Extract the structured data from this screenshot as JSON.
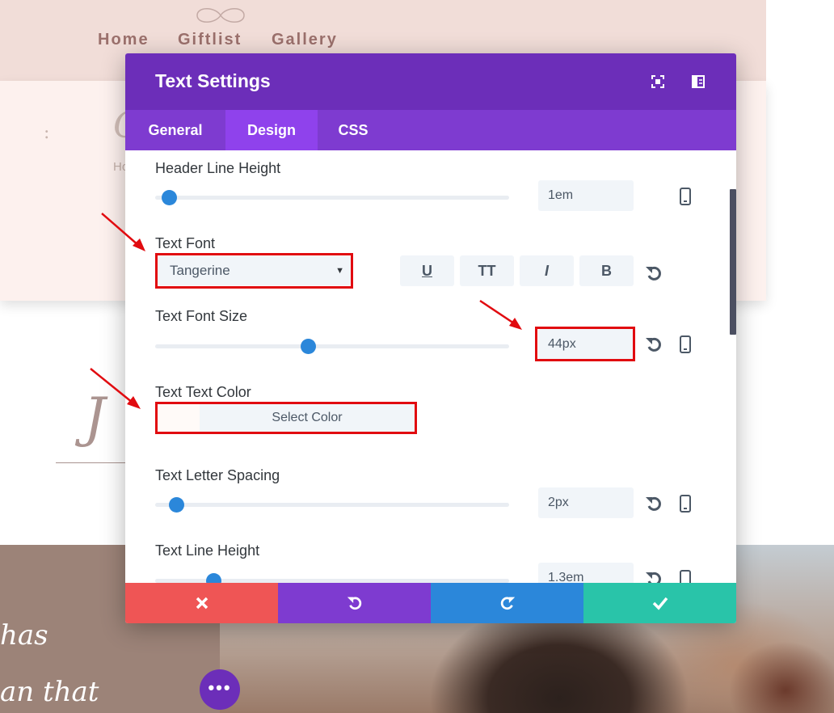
{
  "background": {
    "nav": [
      {
        "label": "Home"
      },
      {
        "label": "Giftlist"
      },
      {
        "label": "Gallery"
      }
    ],
    "hero_glyph": ":",
    "hero_script": "C",
    "hero_small": "Ho",
    "section_script": "J",
    "quote_line1": "has",
    "quote_line2": "an that",
    "fab_icon": "more-dots-icon",
    "fab_label": "•••"
  },
  "colors": {
    "modal_header": "#6c2eb9",
    "tab_bar": "#7e3bd0",
    "tab_active": "#8f42ec",
    "slider_thumb": "#2b87da",
    "highlight": "#e10b10",
    "footer_cancel": "#ef5555",
    "footer_undo": "#7e3bd0",
    "footer_redo": "#2b87da",
    "footer_save": "#29c4a9"
  },
  "modal": {
    "title": "Text Settings",
    "header_icons": [
      "expand-icon",
      "sidebar-layout-icon"
    ],
    "tabs": [
      {
        "label": "General",
        "active": false
      },
      {
        "label": "Design",
        "active": true
      },
      {
        "label": "CSS",
        "active": false
      }
    ],
    "settings": {
      "header_line_height": {
        "label": "Header Line Height",
        "value": "1em",
        "slider_fraction": 0.02
      },
      "text_font": {
        "label": "Text Font",
        "selected": "Tangerine",
        "style_buttons": [
          "U",
          "TT",
          "I",
          "B"
        ]
      },
      "text_font_size": {
        "label": "Text Font Size",
        "value": "44px",
        "slider_fraction": 0.43
      },
      "text_color": {
        "label": "Text Text Color",
        "button": "Select Color"
      },
      "text_letter_spacing": {
        "label": "Text Letter Spacing",
        "value": "2px",
        "slider_fraction": 0.04
      },
      "text_line_height": {
        "label": "Text Line Height",
        "value": "1.3em",
        "slider_fraction": 0.15
      }
    },
    "footer": [
      "close-icon",
      "undo-icon",
      "redo-icon",
      "check-icon"
    ]
  }
}
